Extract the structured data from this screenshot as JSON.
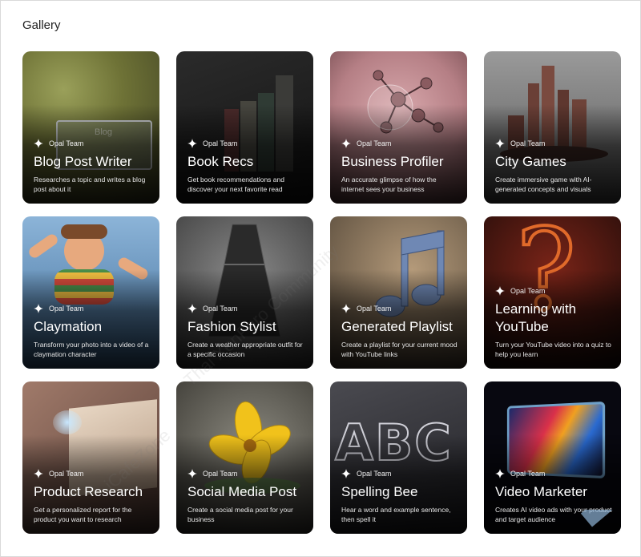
{
  "page": {
    "title": "Gallery"
  },
  "cards": [
    {
      "badge": "Opal Team",
      "title": "Blog Post Writer",
      "desc": "Researches a topic and writes a blog post about it",
      "art": "blog"
    },
    {
      "badge": "Opal Team",
      "title": "Book Recs",
      "desc": "Get book recommendations and discover your next favorite read",
      "art": "books"
    },
    {
      "badge": "Opal Team",
      "title": "Business Profiler",
      "desc": "An accurate glimpse of how the internet sees your business",
      "art": "molecule"
    },
    {
      "badge": "Opal Team",
      "title": "City Games",
      "desc": "Create immersive game with AI-generated concepts and visuals",
      "art": "city"
    },
    {
      "badge": "Opal Team",
      "title": "Claymation",
      "desc": "Transform your photo into a video of a claymation character",
      "art": "clay"
    },
    {
      "badge": "Opal Team",
      "title": "Fashion Stylist",
      "desc": "Create a weather appropriate outfit for a specific occasion",
      "art": "dress"
    },
    {
      "badge": "Opal Team",
      "title": "Generated Playlist",
      "desc": "Create a playlist for your current mood with YouTube links",
      "art": "note"
    },
    {
      "badge": "Opal Team",
      "title": "Learning with YouTube",
      "desc": "Turn your YouTube video into a quiz to help you learn",
      "art": "question"
    },
    {
      "badge": "Opal Team",
      "title": "Product Research",
      "desc": "Get a personalized report for the product you want to research",
      "art": "paper"
    },
    {
      "badge": "Opal Team",
      "title": "Social Media Post",
      "desc": "Create a social media post for your business",
      "art": "flower"
    },
    {
      "badge": "Opal Team",
      "title": "Spelling Bee",
      "desc": "Hear a word and example sentence, then spell it",
      "art": "abc"
    },
    {
      "badge": "Opal Team",
      "title": "Video Marketer",
      "desc": "Creates AI video ads with your product and target audience",
      "art": "screen"
    }
  ],
  "art_text": {
    "blog": "Blog",
    "abc": "ABC",
    "question": "?"
  },
  "watermark": {
    "text1": "iCafeZone",
    "text2": "Thai XenForo Community",
    "corner": "iCafeZone"
  }
}
